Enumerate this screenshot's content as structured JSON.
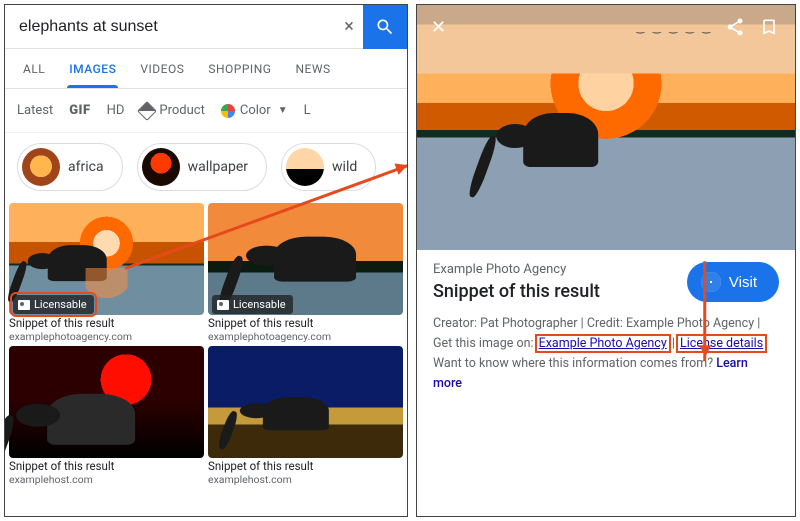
{
  "left": {
    "search": {
      "query": "elephants at sunset",
      "clear": "×"
    },
    "tabs": {
      "all": "ALL",
      "images": "IMAGES",
      "videos": "VIDEOS",
      "shopping": "SHOPPING",
      "news": "NEWS"
    },
    "filters": {
      "latest": "Latest",
      "gif": "GIF",
      "hd": "HD",
      "product": "Product",
      "color": "Color",
      "license": "L"
    },
    "chips": {
      "c1": "africa",
      "c2": "wallpaper",
      "c3": "wild"
    },
    "badge": "Licensable",
    "cells": [
      {
        "snip": "Snippet of this result",
        "src": "examplephotoagency.com"
      },
      {
        "snip": "Snippet of this result",
        "src": "examplephotoagency.com"
      },
      {
        "snip": "Snippet of this result",
        "src": "examplehost.com"
      },
      {
        "snip": "Snippet of this result",
        "src": "examplehost.com"
      }
    ]
  },
  "right": {
    "agency": "Example Photo Agency",
    "title": "Snippet of this result",
    "visit": "Visit",
    "creator_label": "Creator:",
    "creator": "Pat Photographer",
    "credit_label": "Credit:",
    "credit": "Example Photo Agency",
    "get_label": "Get this image on:",
    "get_link1": "Example Photo Agency",
    "get_link2": "License details",
    "want_label": "Want to know where this information comes from?",
    "learn": "Learn more"
  },
  "sep": " | "
}
